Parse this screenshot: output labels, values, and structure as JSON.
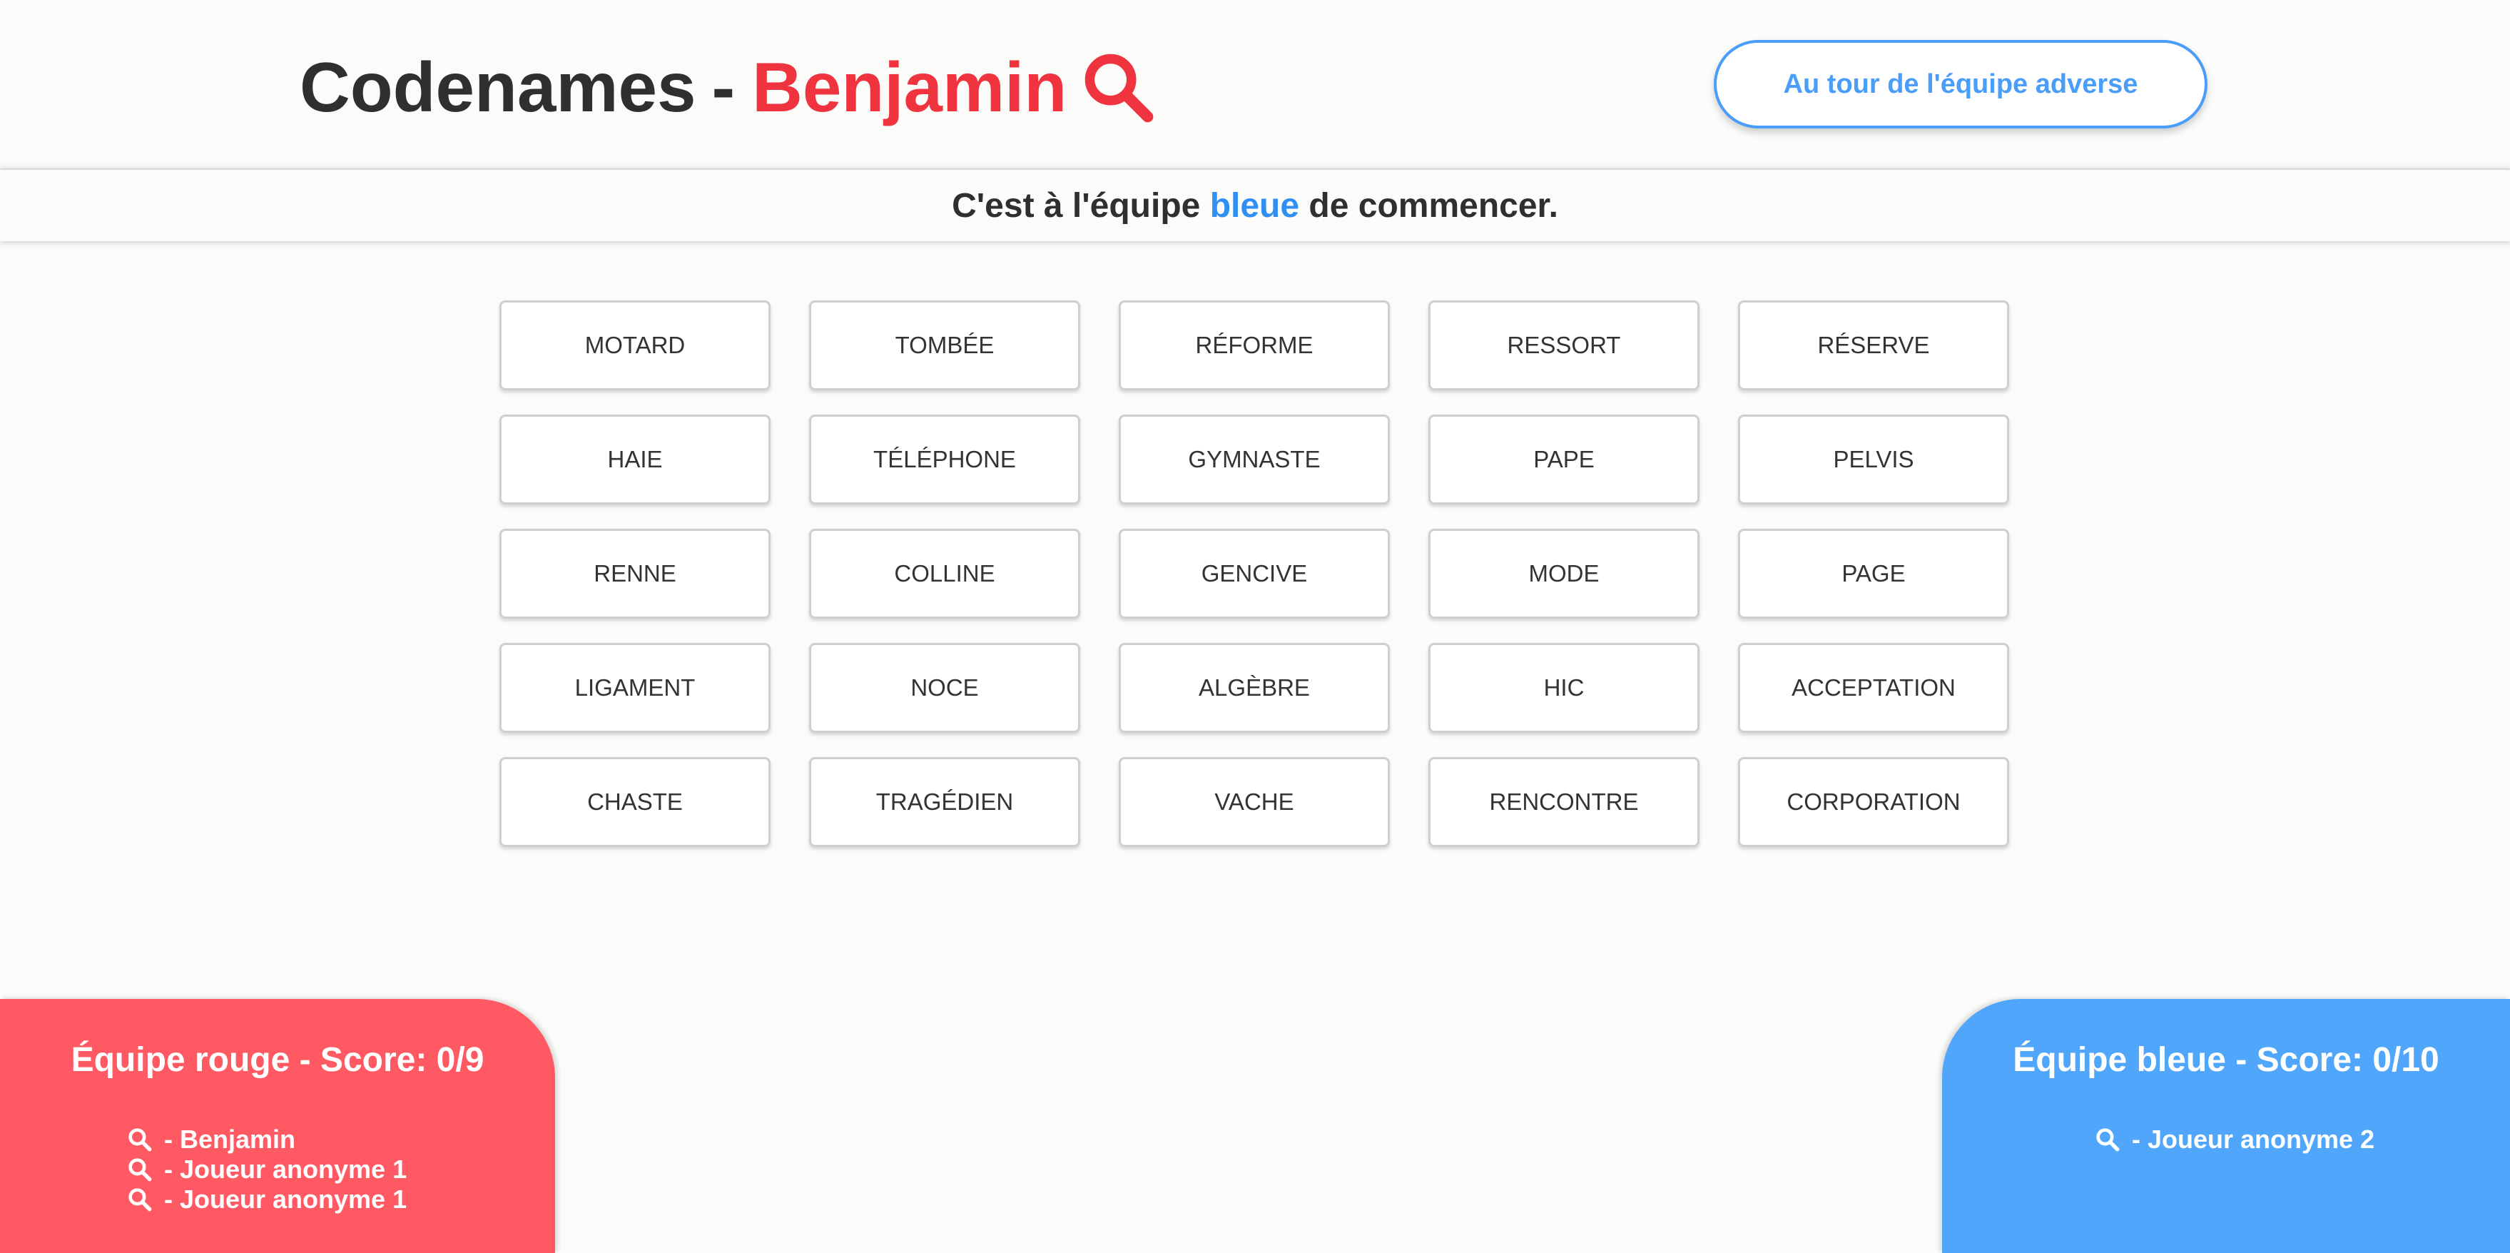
{
  "header": {
    "title_prefix": "Codenames",
    "title_dash": "-",
    "player_name": "Benjamin",
    "title_icon": "magnifier-icon",
    "turn_button_label": "Au tour de l'équipe adverse"
  },
  "banner": {
    "before": "C'est à l'équipe ",
    "team": "bleue",
    "after": " de commencer."
  },
  "cards": [
    "MOTARD",
    "TOMBÉE",
    "RÉFORME",
    "RESSORT",
    "RÉSERVE",
    "HAIE",
    "TÉLÉPHONE",
    "GYMNASTE",
    "PAPE",
    "PELVIS",
    "RENNE",
    "COLLINE",
    "GENCIVE",
    "MODE",
    "PAGE",
    "LIGAMENT",
    "NOCE",
    "ALGÈBRE",
    "HIC",
    "ACCEPTATION",
    "CHASTE",
    "TRAGÉDIEN",
    "VACHE",
    "RENCONTRE",
    "CORPORATION"
  ],
  "teams": {
    "red": {
      "title": "Équipe rouge - Score: 0/9",
      "players": [
        " - Benjamin",
        " - Joueur anonyme 1",
        " - Joueur anonyme 1"
      ]
    },
    "blue": {
      "title": "Équipe bleue - Score: 0/10",
      "players": [
        " - Joueur anonyme 2"
      ]
    }
  },
  "colors": {
    "accent_red": "#f0343f",
    "accent_blue": "#2f8ff2",
    "red_panel": "#ff5a64",
    "blue_panel": "#50a6fb",
    "button_border": "#4a9df8",
    "background": "#fbfbf9"
  }
}
